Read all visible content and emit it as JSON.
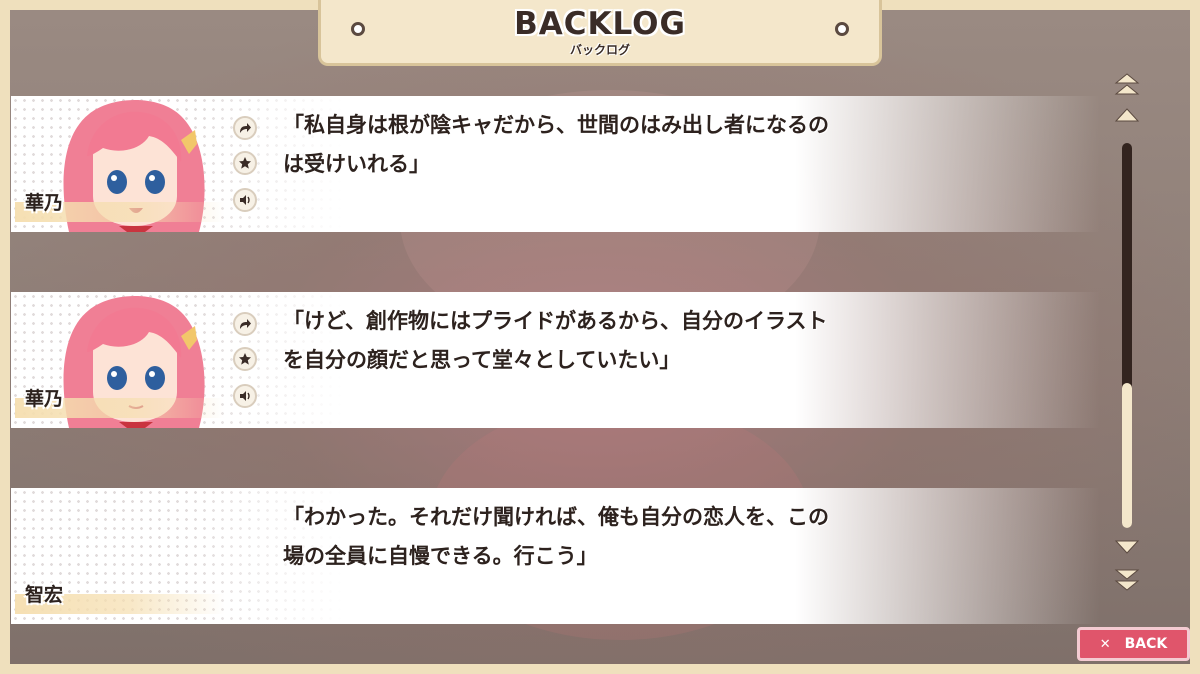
{
  "header": {
    "title": "BACKLOG",
    "subtitle": "バックログ"
  },
  "entries": [
    {
      "speaker": "華乃",
      "lines": [
        "「私自身は根が陰キャだから、世間のはみ出し者になるの",
        "は受けいれる」"
      ],
      "has_voice": true
    },
    {
      "speaker": "華乃",
      "lines": [
        "「けど、創作物にはプライドがあるから、自分のイラスト",
        "を自分の顔だと思って堂々としていたい」"
      ],
      "has_voice": true
    },
    {
      "speaker": "智宏",
      "lines": [
        "「わかった。それだけ聞ければ、俺も自分の恋人を、この",
        "場の全員に自慢できる。行こう」"
      ],
      "has_voice": false
    }
  ],
  "icons": {
    "jump": "jump-arrow-icon",
    "favorite": "star-icon",
    "voice": "speaker-icon",
    "page_up": "double-chevron-up-icon",
    "line_up": "chevron-up-icon",
    "line_down": "chevron-down-icon",
    "page_down": "double-chevron-down-icon",
    "close": "close-icon"
  },
  "scrollbar": {
    "position": 1.0
  },
  "back_button": {
    "label": "BACK"
  },
  "colors": {
    "frame": "#efe0bd",
    "text": "#2d221e",
    "back_button": "#e0556b",
    "hair": "#f07f95"
  }
}
